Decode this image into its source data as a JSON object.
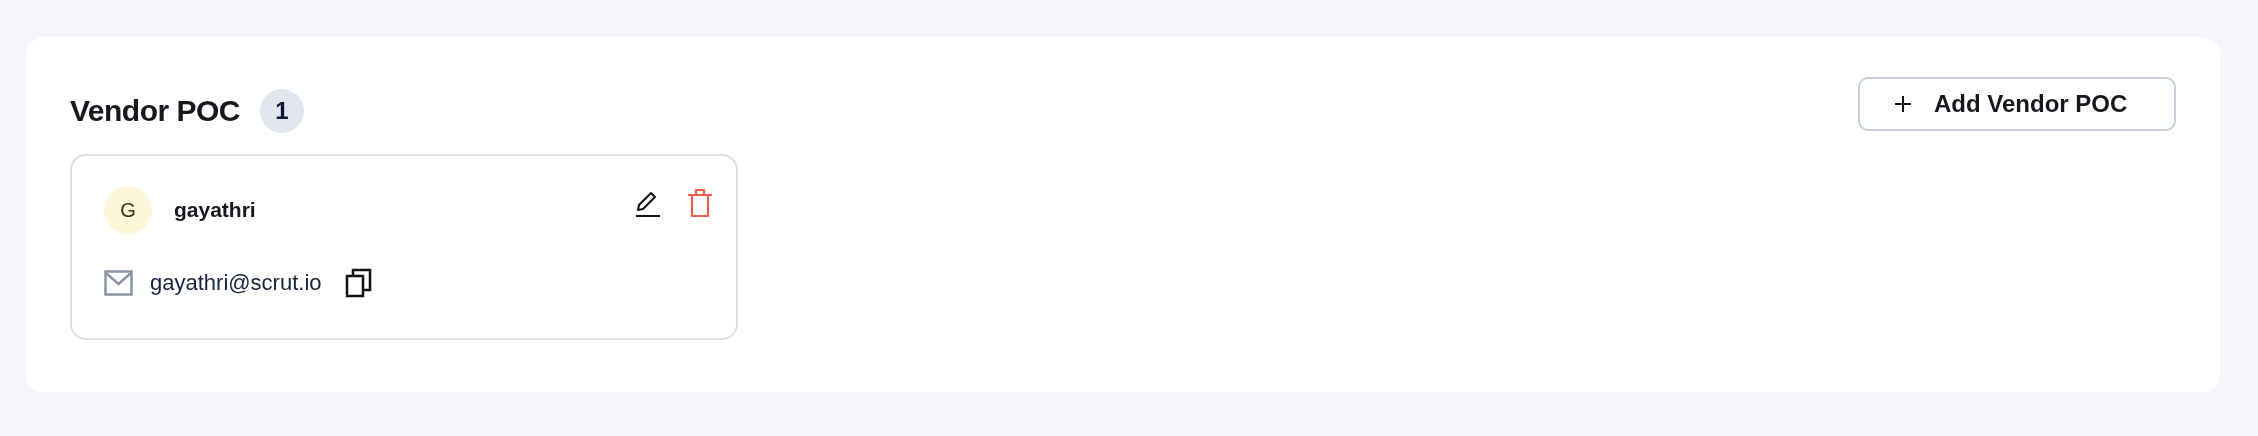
{
  "section": {
    "title": "Vendor POC",
    "count": "1"
  },
  "add_button": {
    "label": "Add Vendor POC"
  },
  "contacts": [
    {
      "initial": "G",
      "name": "gayathri",
      "email": "gayathri@scrut.io"
    }
  ]
}
